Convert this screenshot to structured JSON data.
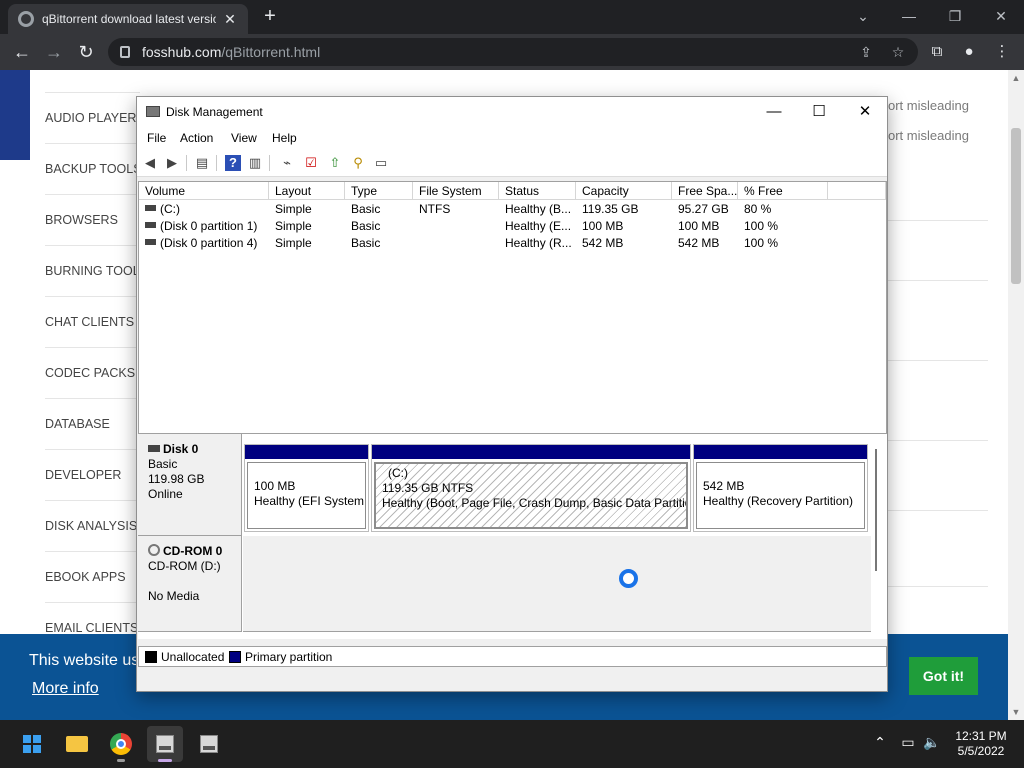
{
  "browser": {
    "tab_title": "qBittorrent download latest version",
    "new_tab_label": "+",
    "url_domain": "fosshub.com",
    "url_path": "/qBittorrent.html",
    "window_controls": {
      "minimize": "⌄",
      "restore": "—",
      "maximize": "❐",
      "close": "✕"
    }
  },
  "page": {
    "sidebar_items": [
      "AUDIO PLAYERS",
      "BACKUP TOOLS",
      "BROWSERS",
      "BURNING TOOLS",
      "CHAT CLIENTS",
      "CODEC PACKS",
      "DATABASE",
      "DEVELOPER",
      "DISK ANALYSIS",
      "EBOOK APPS",
      "EMAIL CLIENTS"
    ],
    "right_text_1": "ort misleading",
    "right_text_2": "ort misleading",
    "cookie_message": "This website us",
    "cookie_more": "More info",
    "cookie_button": "Got it!"
  },
  "disk_mgmt": {
    "title": "Disk Management",
    "controls": {
      "minimize": "—",
      "maximize": "☐",
      "close": "✕"
    },
    "menu": [
      "File",
      "Action",
      "View",
      "Help"
    ],
    "columns": [
      "Volume",
      "Layout",
      "Type",
      "File System",
      "Status",
      "Capacity",
      "Free Spa...",
      "% Free"
    ],
    "volumes": [
      {
        "volume": "(C:)",
        "layout": "Simple",
        "type": "Basic",
        "fs": "NTFS",
        "status": "Healthy (B...",
        "capacity": "119.35 GB",
        "free": "95.27 GB",
        "pct": "80 %"
      },
      {
        "volume": "(Disk 0 partition 1)",
        "layout": "Simple",
        "type": "Basic",
        "fs": "",
        "status": "Healthy (E...",
        "capacity": "100 MB",
        "free": "100 MB",
        "pct": "100 %"
      },
      {
        "volume": "(Disk 0 partition 4)",
        "layout": "Simple",
        "type": "Basic",
        "fs": "",
        "status": "Healthy (R...",
        "capacity": "542 MB",
        "free": "542 MB",
        "pct": "100 %"
      }
    ],
    "disk0": {
      "name": "Disk 0",
      "type": "Basic",
      "size": "119.98 GB",
      "state": "Online",
      "partitions": [
        {
          "name": "",
          "size": "100 MB",
          "status": "Healthy (EFI System Partition)"
        },
        {
          "name": "(C:)",
          "size": "119.35 GB NTFS",
          "status": "Healthy (Boot, Page File, Crash Dump, Basic Data Partition)"
        },
        {
          "name": "",
          "size": "542 MB",
          "status": "Healthy (Recovery Partition)"
        }
      ]
    },
    "cdrom": {
      "name": "CD-ROM 0",
      "drive": "CD-ROM (D:)",
      "media": "No Media"
    },
    "legend": [
      "Unallocated",
      "Primary partition"
    ],
    "colors": {
      "unallocated": "#000000",
      "primary": "#000080"
    }
  },
  "taskbar": {
    "time": "12:31 PM",
    "date": "5/5/2022",
    "apps": [
      "start",
      "file-explorer",
      "chrome",
      "disk-management",
      "disk-management-2"
    ]
  }
}
